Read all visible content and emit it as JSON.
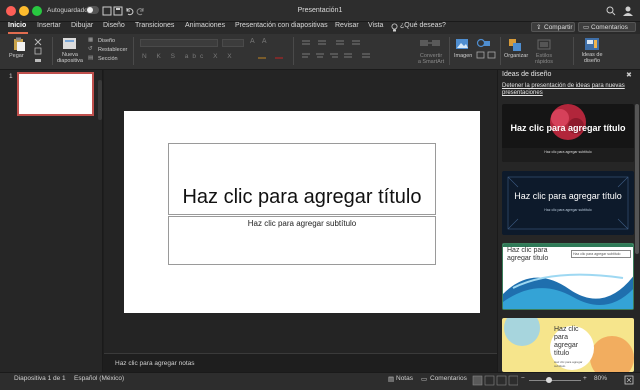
{
  "window": {
    "title": "Presentación1",
    "autosave_label": "Autoguardado",
    "autosave_state": "•",
    "traffic_colors": [
      "#fe5f57",
      "#febc2e",
      "#28c840"
    ]
  },
  "tabs": [
    {
      "label": "Inicio"
    },
    {
      "label": "Insertar"
    },
    {
      "label": "Dibujar"
    },
    {
      "label": "Diseño"
    },
    {
      "label": "Transiciones"
    },
    {
      "label": "Animaciones"
    },
    {
      "label": "Presentación con diapositivas"
    },
    {
      "label": "Revisar"
    },
    {
      "label": "Vista"
    }
  ],
  "tell_me": "¿Qué deseas?",
  "share_label": "Compartir",
  "comments_label": "Comentarios",
  "ribbon": {
    "paste": "Pegar",
    "new_slide": "Nueva\ndiapositiva",
    "layout": "Diseño",
    "reset": "Restablecer",
    "section": "Sección",
    "smartart": "Convertir\na SmartArt",
    "image": "Imagen",
    "organize": "Organizar",
    "quick_styles": "Estilos\nrápidos",
    "design_ideas": "Ideas de\ndiseño"
  },
  "slide": {
    "number": "1",
    "title_placeholder": "Haz clic para agregar título",
    "subtitle_placeholder": "Haz clic para agregar subtítulo"
  },
  "notes_placeholder": "Haz clic para agregar notas",
  "design_pane": {
    "title": "Ideas de diseño",
    "stop_link": "Detener la presentación de ideas para nuevas presentaciones",
    "cards": [
      {
        "title": "Haz clic para agregar título",
        "sub": "Haz clic para agregar subtítulo"
      },
      {
        "title": "Haz clic para agregar título",
        "sub": "Haz clic para agregar subtítulo"
      },
      {
        "title": "Haz clic para agregar título",
        "sub": "Haz clic para agregar subtítulo"
      },
      {
        "title": "Haz clic para agregar título",
        "sub": "Haz clic para agregar subtítulo"
      }
    ]
  },
  "status": {
    "slide_count": "Diapositiva 1 de 1",
    "language": "Español (México)",
    "notes": "Notas",
    "comments": "Comentarios",
    "zoom": "80%"
  }
}
